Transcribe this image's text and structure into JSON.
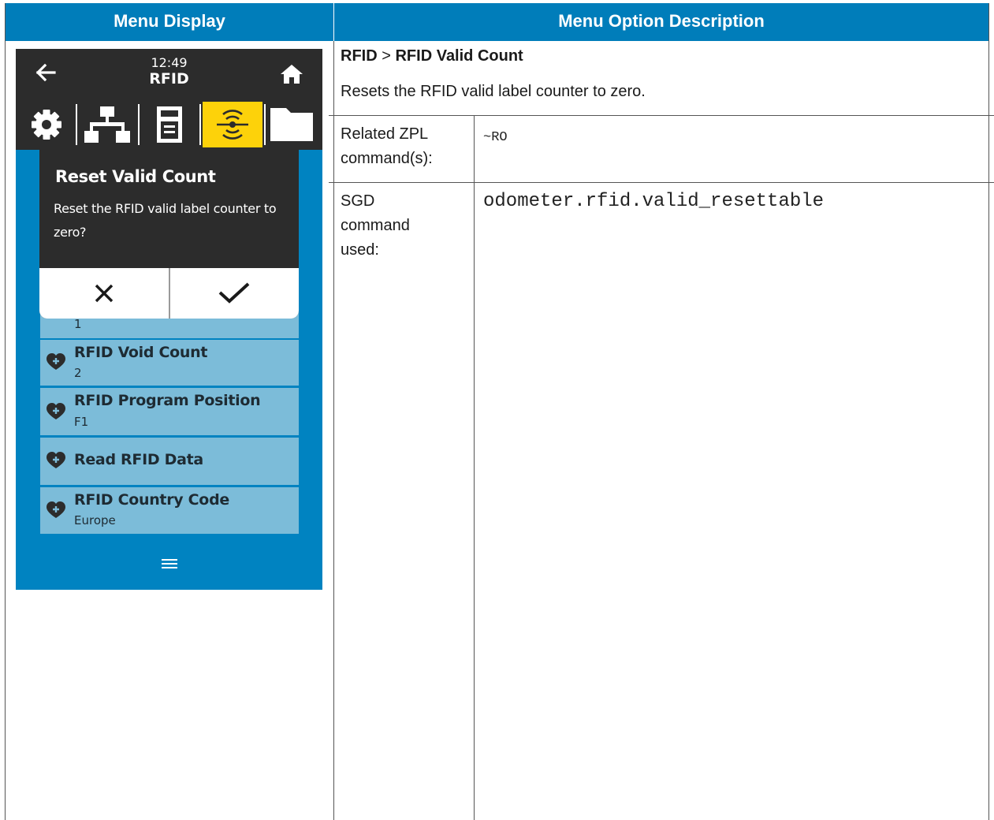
{
  "table": {
    "header_left": "Menu Display",
    "header_right": "Menu Option Description"
  },
  "description": {
    "path_parent": "RFID",
    "path_separator": ">",
    "path_item": "RFID Valid Count",
    "summary": "Resets the RFID valid label counter to zero.",
    "rows": [
      {
        "label": "Related ZPL command(s):",
        "value": "~RO"
      },
      {
        "label": "SGD command used:",
        "value": "odometer.rfid.valid_resettable"
      }
    ]
  },
  "screen": {
    "time": "12:49",
    "title": "RFID",
    "tabs": [
      "gear-icon",
      "network-icon",
      "printer-icon",
      "rfid-icon",
      "folder-icon"
    ],
    "active_tab": "rfid-icon",
    "dialog": {
      "title": "Reset Valid Count",
      "message": "Reset the RFID valid label counter to zero?",
      "cancel_icon": "close-icon",
      "confirm_icon": "checkmark-icon"
    },
    "list": [
      {
        "title": "",
        "value": "1"
      },
      {
        "title": "RFID Void Count",
        "value": "2"
      },
      {
        "title": "RFID Program Position",
        "value": "F1"
      },
      {
        "title": "Read RFID Data",
        "value": ""
      },
      {
        "title": "RFID Country Code",
        "value": "Europe"
      }
    ],
    "colors": {
      "header_blue": "#007dba",
      "screen_blue": "#0083c1",
      "list_item": "#7cbcd9",
      "active_tab": "#fdd20a",
      "bar_dark": "#2c2c2c"
    }
  }
}
